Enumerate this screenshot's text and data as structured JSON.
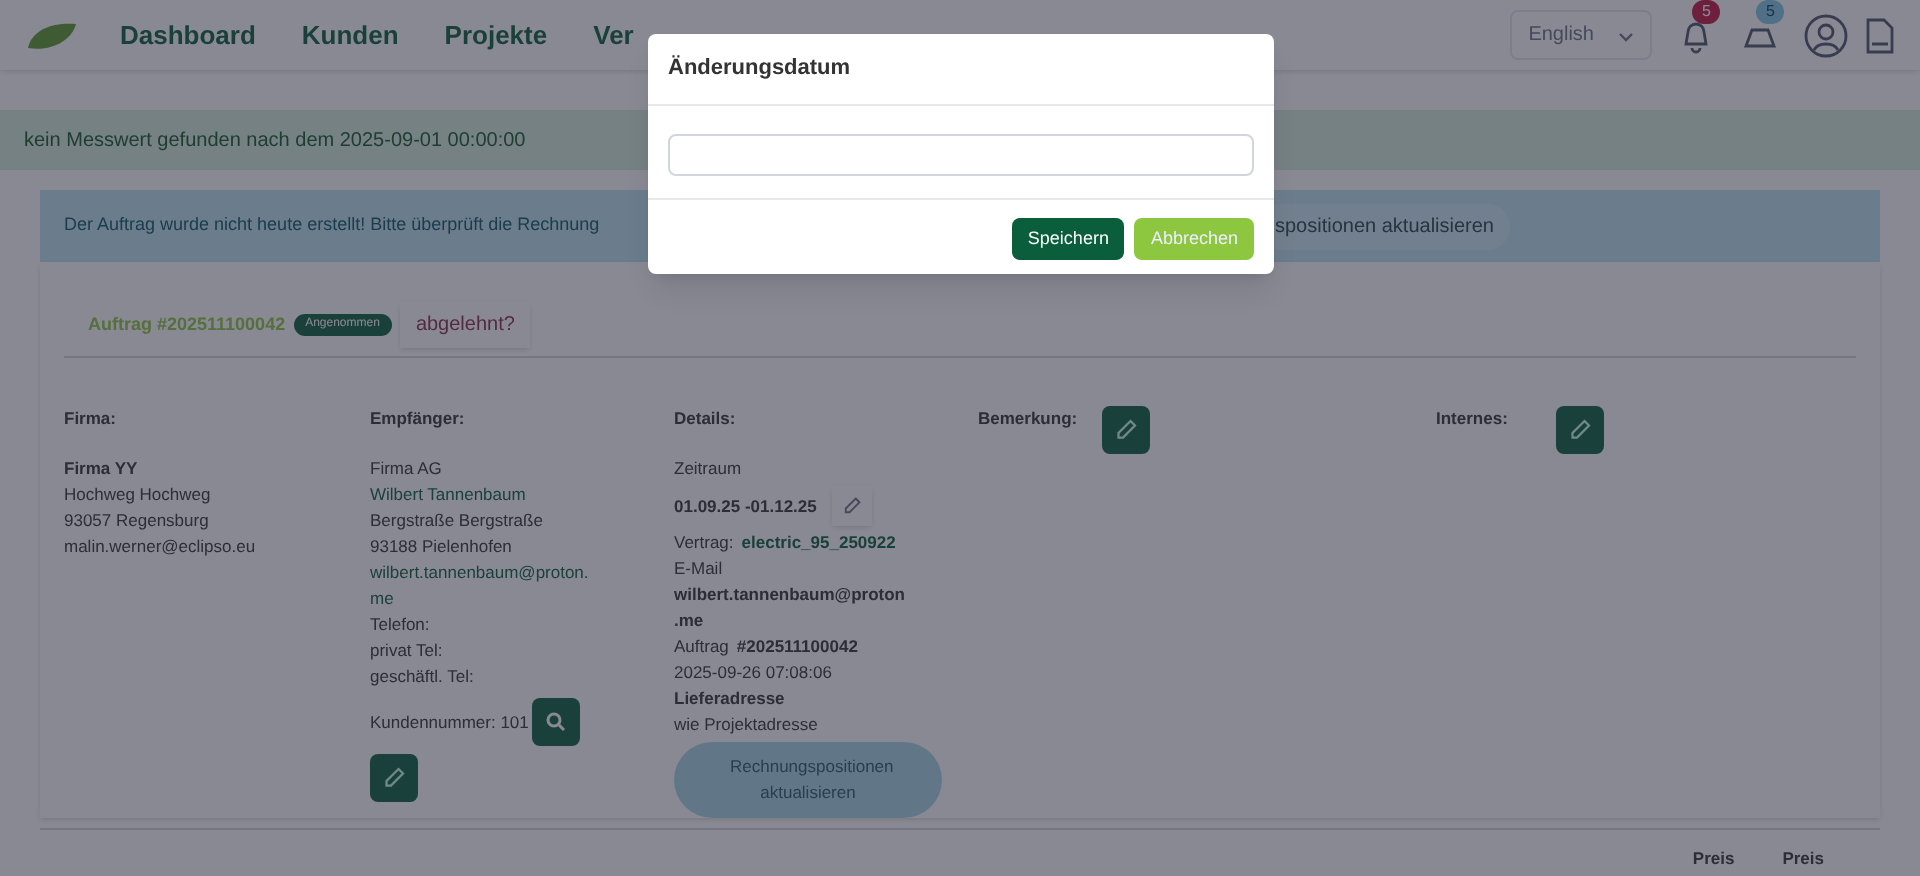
{
  "nav": {
    "items": [
      "Dashboard",
      "Kunden",
      "Projekte",
      "Ver"
    ],
    "language": "English",
    "notifications": "5",
    "messages": "5"
  },
  "alerts": {
    "success": "kein Messwert gefunden nach dem 2025-09-01 00:00:00",
    "info": "Der Auftrag wurde nicht heute erstellt! Bitte überprüft die Rechnung",
    "info_button": "spositionen aktualisieren"
  },
  "order": {
    "title": "Auftrag #202511100042",
    "status": "Angenommen",
    "reject": "abgelehnt?"
  },
  "firma": {
    "heading": "Firma:",
    "name": "Firma YY",
    "lines": [
      "Hochweg Hochweg",
      "93057 Regensburg",
      "malin.werner@eclipso.eu"
    ]
  },
  "recipient": {
    "heading": "Empfänger:",
    "company": "Firma AG",
    "person": "Wilbert Tannenbaum",
    "street": "Bergstraße Bergstraße",
    "city": "93188 Pielenhofen",
    "email": "wilbert.tannenbaum@proton.\nme",
    "phone": "Telefon:",
    "private": "privat Tel:",
    "business": "geschäftl. Tel:",
    "customer_no": "Kundennummer: 101"
  },
  "details": {
    "heading": "Details:",
    "period_label": "Zeitraum",
    "period": "01.09.25 -01.12.25",
    "contract_label": "Vertrag:",
    "contract": "electric_95_250922",
    "email_label": "E-Mail",
    "email": "wilbert.tannenbaum@proton\n.me",
    "order_label": "Auftrag",
    "order": "#202511100042",
    "created": "2025-09-26 07:08:06",
    "delivery_label": "Lieferadresse",
    "delivery": "wie Projektadresse",
    "update_button": "Rechnungspositionen aktualisieren"
  },
  "remark": {
    "heading": "Bemerkung:"
  },
  "internal": {
    "heading": "Internes:"
  },
  "table": {
    "columns": [
      "Preis",
      "Preis"
    ]
  },
  "modal": {
    "title": "Änderungsdatum",
    "save": "Speichern",
    "cancel": "Abbrechen"
  }
}
